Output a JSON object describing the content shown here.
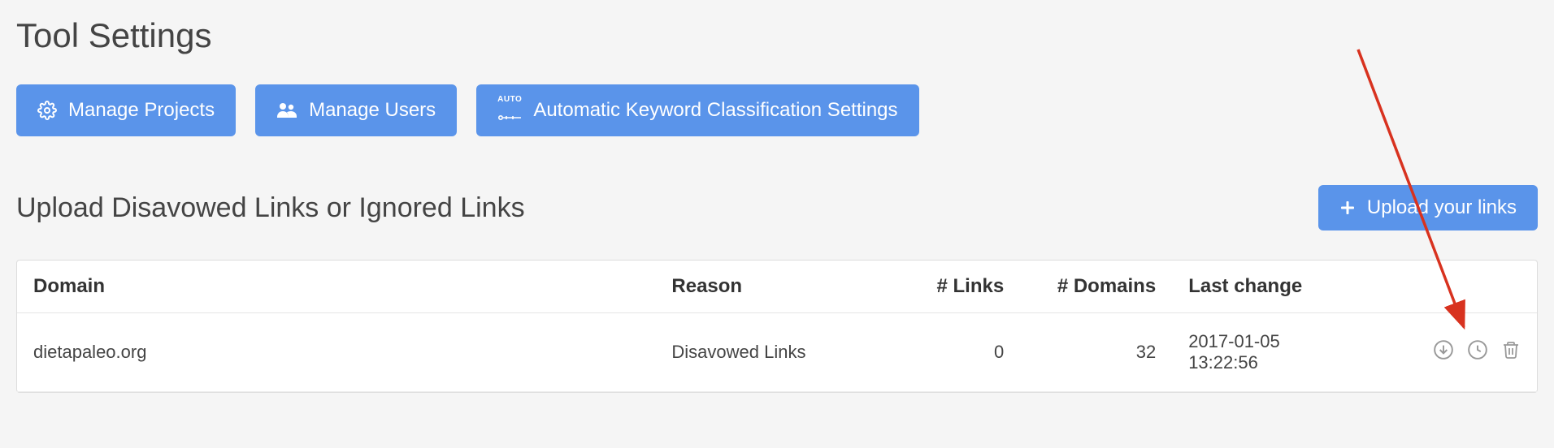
{
  "page": {
    "title": "Tool Settings"
  },
  "buttons": {
    "manage_projects": "Manage Projects",
    "manage_users": "Manage Users",
    "auto_keyword": "Automatic Keyword Classification Settings",
    "upload_links": "Upload your links"
  },
  "section": {
    "title": "Upload Disavowed Links or Ignored Links"
  },
  "table": {
    "headers": {
      "domain": "Domain",
      "reason": "Reason",
      "links": "# Links",
      "domains": "# Domains",
      "last_change": "Last change"
    },
    "rows": [
      {
        "domain": "dietapaleo.org",
        "reason": "Disavowed Links",
        "links": "0",
        "domains": "32",
        "last_change": "2017-01-05 13:22:56"
      }
    ]
  },
  "colors": {
    "primary": "#5a94ea",
    "arrow": "#d8321f"
  }
}
